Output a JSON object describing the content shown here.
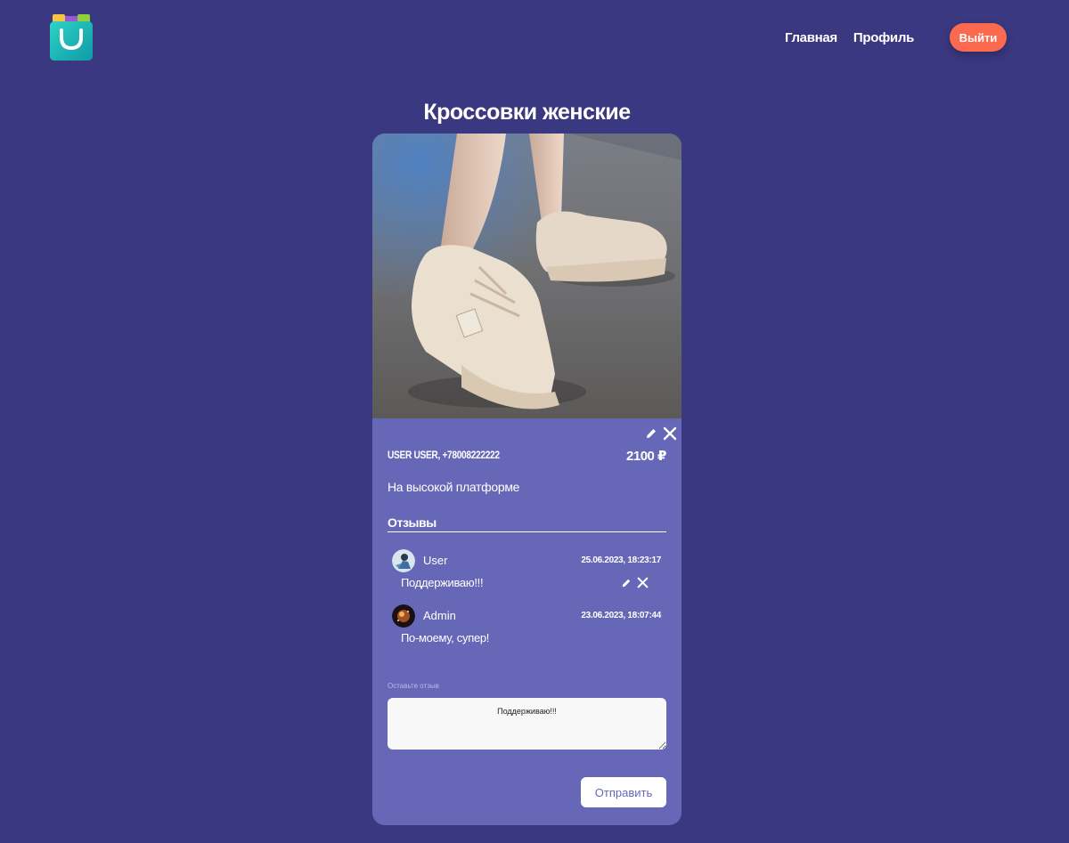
{
  "header": {
    "logo_icon": "shopping-bag-icon",
    "nav": [
      {
        "label": "Главная"
      },
      {
        "label": "Профиль"
      }
    ],
    "logout_label": "Выйти"
  },
  "product": {
    "title": "Кроссовки женские",
    "seller": "USER USER, +78008222222",
    "price": "2100 ₽",
    "description": "На высокой платформе"
  },
  "reviews": {
    "title": "Отзывы",
    "items": [
      {
        "author": "User",
        "date": "25.06.2023, 18:23:17",
        "text": "Поддерживаю!!!"
      },
      {
        "author": "Admin",
        "date": "23.06.2023, 18:07:44",
        "text": "По-моему, супер!"
      }
    ]
  },
  "review_form": {
    "label": "Оставьте отзыв",
    "value": "Поддерживаю!!!",
    "submit_label": "Отправить"
  },
  "colors": {
    "background": "#3a3880",
    "card": "#6767b8",
    "accent": "#fb6a4e"
  }
}
